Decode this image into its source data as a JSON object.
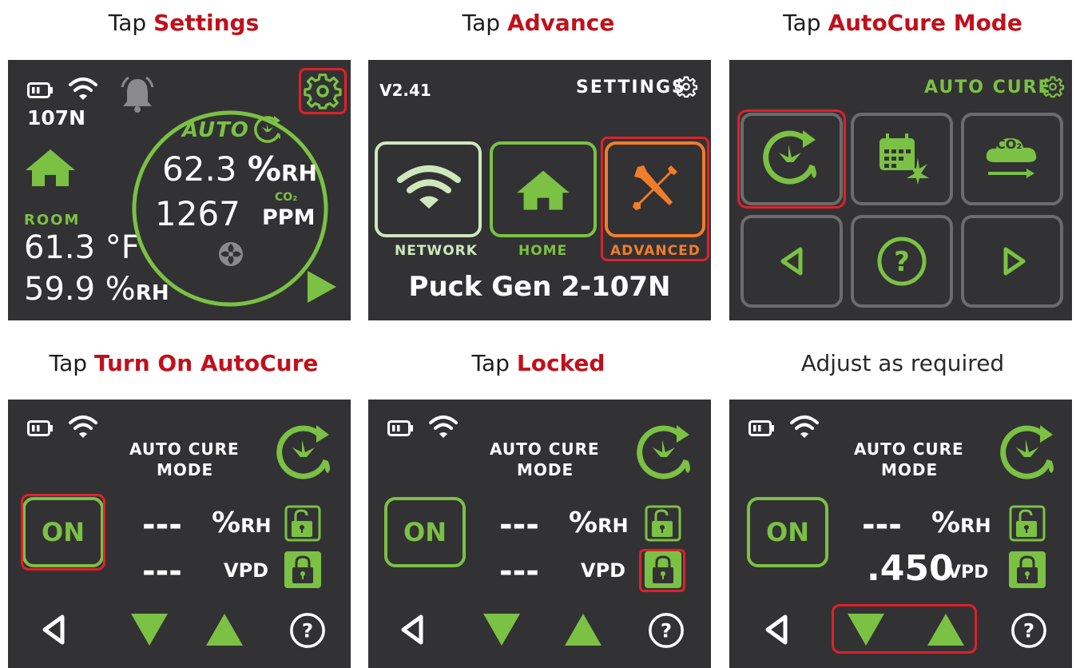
{
  "captions": [
    {
      "prefix": "Tap ",
      "action": "Settings"
    },
    {
      "prefix": "Tap ",
      "action": "Advance"
    },
    {
      "prefix": "Tap ",
      "action": "AutoCure Mode"
    },
    {
      "prefix": "Tap ",
      "action": "Turn On AutoCure"
    },
    {
      "prefix": "Tap ",
      "action": "Locked"
    },
    {
      "plain": "Adjust as required"
    }
  ],
  "screen1": {
    "device_id": "107N",
    "auto_label": "AUTO",
    "rh_value": "62.3",
    "rh_unit_pct": "%",
    "rh_unit": "RH",
    "co2_value": "1267",
    "co2_label": "CO₂",
    "co2_unit": "PPM",
    "room_label": "ROOM",
    "room_temp": "61.3 °F",
    "room_rh_value": "59.9",
    "room_rh_pct": "%",
    "room_rh_unit": "RH",
    "icons": [
      "battery-icon",
      "wifi-icon",
      "bell-icon",
      "gear-icon",
      "home-icon",
      "auto-cure-icon",
      "fan-icon",
      "play-icon"
    ]
  },
  "screen2": {
    "version": "V2.41",
    "title": "SETTINGS",
    "tiles": [
      {
        "label": "NETWORK",
        "icon": "wifi-icon"
      },
      {
        "label": "HOME",
        "icon": "home-icon"
      },
      {
        "label": "ADVANCED",
        "icon": "tools-icon"
      }
    ],
    "device_name": "Puck Gen 2-107N"
  },
  "screen3": {
    "title": "AUTO CURE",
    "tiles": [
      "auto-cure-icon",
      "calendar-leaf-icon",
      "co2-cloud-icon",
      "back-arrow-icon",
      "help-icon",
      "forward-arrow-icon"
    ],
    "co2_label": "CO₂"
  },
  "mode_screens": [
    {
      "title_line1": "AUTO CURE",
      "title_line2": "MODE",
      "on_label": "ON",
      "rh_value": "---",
      "rh_pct": "%",
      "rh_unit": "RH",
      "vpd_value": "---",
      "vpd_unit": "VPD"
    },
    {
      "title_line1": "AUTO CURE",
      "title_line2": "MODE",
      "on_label": "ON",
      "rh_value": "---",
      "rh_pct": "%",
      "rh_unit": "RH",
      "vpd_value": "---",
      "vpd_unit": "VPD"
    },
    {
      "title_line1": "AUTO CURE",
      "title_line2": "MODE",
      "on_label": "ON",
      "rh_value": "---",
      "rh_pct": "%",
      "rh_unit": "RH",
      "vpd_value": ".450",
      "vpd_unit": "VPD"
    }
  ],
  "colors": {
    "accent_green": "#7bc144",
    "highlight_red": "#e0202a",
    "screen_bg": "#323234",
    "tile_border": "#6c6c6e",
    "advanced_orange": "#f07d2a"
  }
}
